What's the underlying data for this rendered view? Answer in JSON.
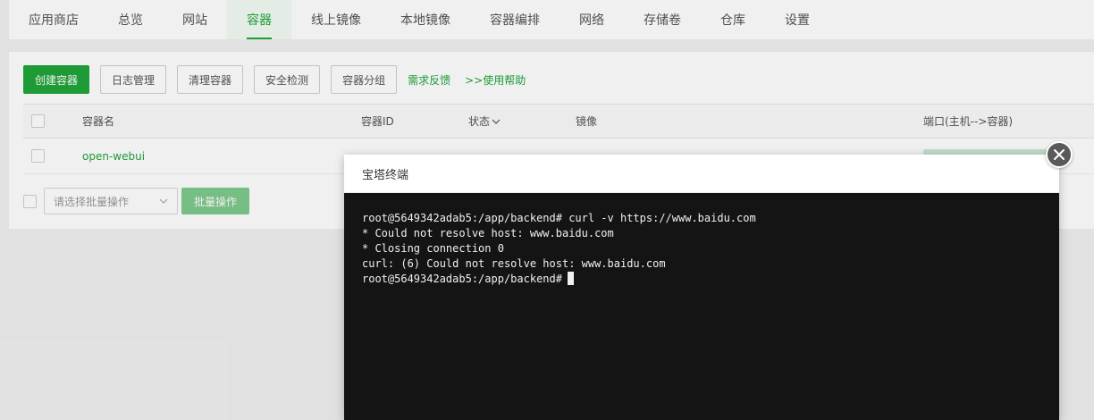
{
  "nav": {
    "items": [
      "应用商店",
      "总览",
      "网站",
      "容器",
      "线上镜像",
      "本地镜像",
      "容器编排",
      "网络",
      "存储卷",
      "仓库",
      "设置"
    ],
    "active": "容器"
  },
  "toolbar": {
    "create_label": "创建容器",
    "log_label": "日志管理",
    "clean_label": "清理容器",
    "security_label": "安全检测",
    "group_label": "容器分组",
    "feedback_label": "需求反馈",
    "help_label": ">>使用帮助"
  },
  "table": {
    "headers": {
      "name": "容器名",
      "id": "容器ID",
      "status": "状态",
      "image": "镜像",
      "ports": "端口(主机-->容器)"
    },
    "rows": [
      {
        "name": "open-webui"
      }
    ]
  },
  "batch": {
    "placeholder": "请选择批量操作",
    "button_label": "批量操作"
  },
  "dialog": {
    "title": "宝塔终端",
    "lines": [
      "root@5649342adab5:/app/backend# curl -v https://www.baidu.com",
      "* Could not resolve host: www.baidu.com",
      "* Closing connection 0",
      "curl: (6) Could not resolve host: www.baidu.com",
      "root@5649342adab5:/app/backend#"
    ]
  },
  "icons": {
    "status_sort": "chevron-down-icon",
    "select_arrow": "chevron-down-icon",
    "close": "close-icon"
  },
  "colors": {
    "accent": "#20a53a",
    "terminal_bg": "#141414",
    "close_bg": "#5a5a5a"
  }
}
